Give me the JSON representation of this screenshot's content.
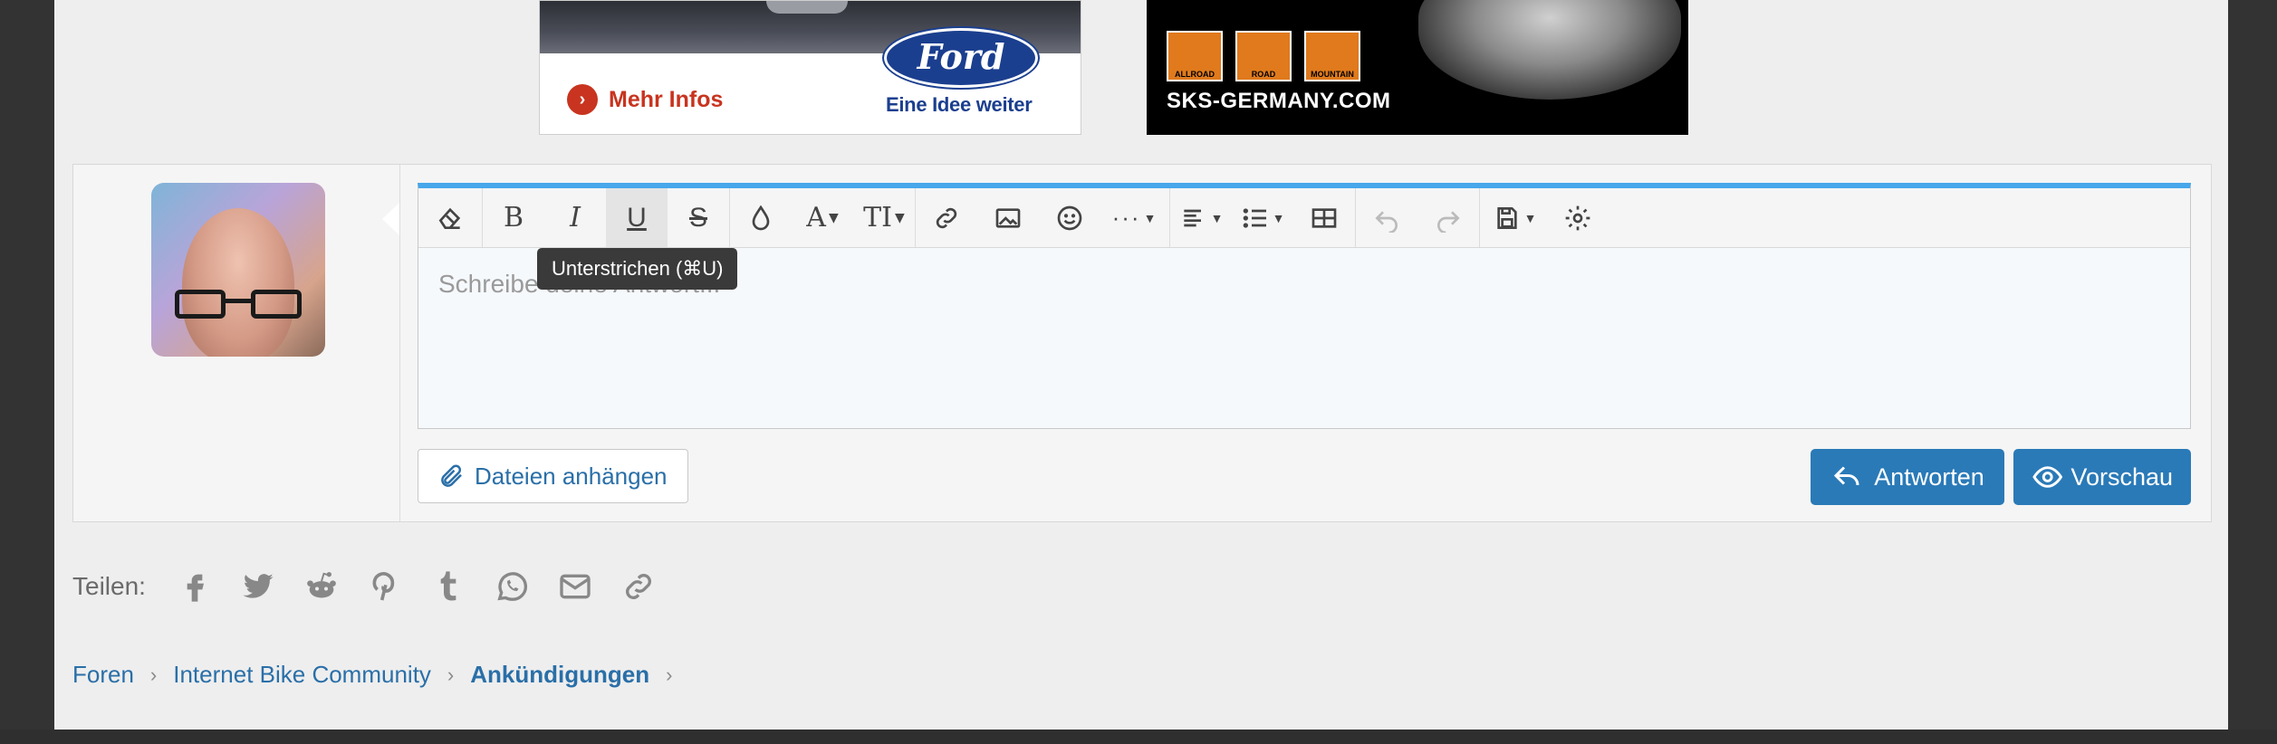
{
  "ads": {
    "ford": {
      "cta": "Mehr Infos",
      "logo": "Ford",
      "tagline": "Eine Idee weiter",
      "brand_color": "#1b3f8f"
    },
    "sks": {
      "badges": [
        "ALLROAD",
        "ROAD",
        "MOUNTAIN"
      ],
      "text": "SKS-GERMANY.COM"
    }
  },
  "editor": {
    "placeholder": "Schreibe deine Antwort...",
    "tooltip": "Unterstrichen (⌘U)",
    "toolbar": [
      {
        "name": "remove-format-icon"
      },
      {
        "name": "bold-icon"
      },
      {
        "name": "italic-icon"
      },
      {
        "name": "underline-icon",
        "active": true
      },
      {
        "name": "strikethrough-icon"
      },
      {
        "name": "text-color-icon"
      },
      {
        "name": "font-family-icon"
      },
      {
        "name": "font-size-icon"
      },
      {
        "name": "link-icon"
      },
      {
        "name": "image-icon"
      },
      {
        "name": "smilie-icon"
      },
      {
        "name": "more-options-icon"
      },
      {
        "name": "align-icon"
      },
      {
        "name": "list-icon"
      },
      {
        "name": "table-icon"
      },
      {
        "name": "undo-icon"
      },
      {
        "name": "redo-icon"
      },
      {
        "name": "drafts-icon"
      },
      {
        "name": "settings-icon"
      }
    ],
    "accent": "#47a7eb"
  },
  "actions": {
    "attach_label": "Dateien anhängen",
    "reply_label": "Antworten",
    "preview_label": "Vorschau",
    "button_color": "#2a7ab8"
  },
  "share": {
    "label": "Teilen:",
    "networks": [
      "facebook",
      "twitter",
      "reddit",
      "pinterest",
      "tumblr",
      "whatsapp",
      "email",
      "link"
    ]
  },
  "breadcrumb": {
    "items": [
      "Foren",
      "Internet Bike Community",
      "Ankündigungen"
    ]
  }
}
